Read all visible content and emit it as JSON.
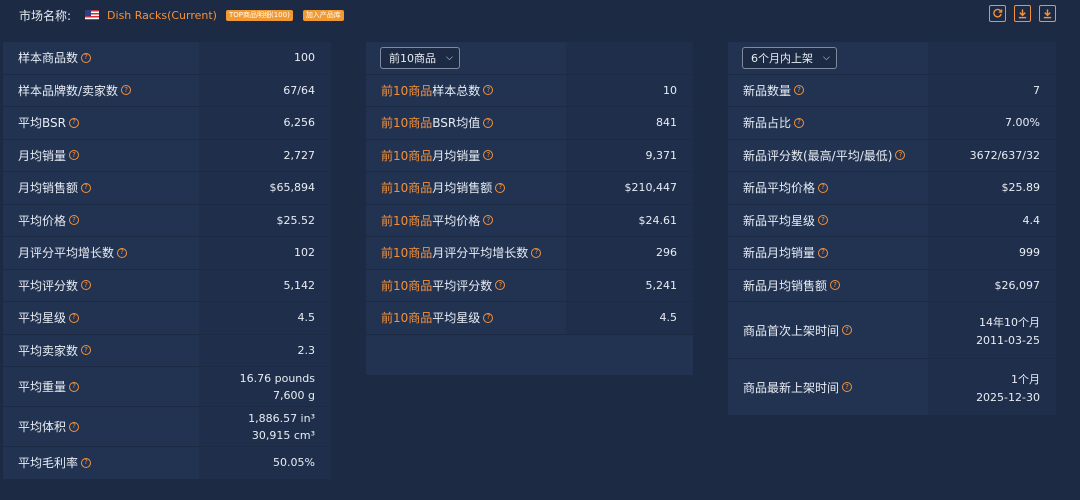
{
  "top": {
    "market_label": "市场名称:",
    "market_name": "Dish Racks(Current)",
    "tag1": "TOP商品明细(100)",
    "tag2": "加入产品库"
  },
  "icons": [
    "refresh-icon",
    "download-icon",
    "download-icon"
  ],
  "panel1": {
    "rows": [
      {
        "label": "样本商品数",
        "value": "100"
      },
      {
        "label": "样本品牌数/卖家数",
        "value": "67/64"
      },
      {
        "label": "平均BSR",
        "value": "6,256"
      },
      {
        "label": "月均销量",
        "value": "2,727"
      },
      {
        "label": "月均销售额",
        "value": "$65,894"
      },
      {
        "label": "平均价格",
        "value": "$25.52"
      },
      {
        "label": "月评分平均增长数",
        "value": "102"
      },
      {
        "label": "平均评分数",
        "value": "5,142"
      },
      {
        "label": "平均星级",
        "value": "4.5"
      },
      {
        "label": "平均卖家数",
        "value": "2.3"
      },
      {
        "label": "平均重量",
        "value": "16.76 pounds",
        "value2": "7,600 g"
      },
      {
        "label": "平均体积",
        "value": "1,886.57 in³",
        "value2": "30,915 cm³"
      },
      {
        "label": "平均毛利率",
        "value": "50.05%"
      }
    ]
  },
  "panel2": {
    "select": "前10商品",
    "prefix": "前10商品",
    "rows": [
      {
        "label": "样本总数",
        "value": "10"
      },
      {
        "label": "BSR均值",
        "value": "841"
      },
      {
        "label": "月均销量",
        "value": "9,371"
      },
      {
        "label": "月均销售额",
        "value": "$210,447"
      },
      {
        "label": "平均价格",
        "value": "$24.61"
      },
      {
        "label": "月评分平均增长数",
        "value": "296"
      },
      {
        "label": "平均评分数",
        "value": "5,241"
      },
      {
        "label": "平均星级",
        "value": "4.5"
      }
    ]
  },
  "panel3": {
    "select": "6个月内上架",
    "rows": [
      {
        "label": "新品数量",
        "value": "7"
      },
      {
        "label": "新品占比",
        "value": "7.00%"
      },
      {
        "label": "新品评分数(最高/平均/最低)",
        "value": "3672/637/32"
      },
      {
        "label": "新品平均价格",
        "value": "$25.89"
      },
      {
        "label": "新品平均星级",
        "value": "4.4"
      },
      {
        "label": "新品月均销量",
        "value": "999"
      },
      {
        "label": "新品月均销售额",
        "value": "$26,097"
      },
      {
        "label": "商品首次上架时间",
        "value": "14年10个月",
        "value2": "2011-03-25"
      },
      {
        "label": "商品最新上架时间",
        "value": "1个月",
        "value2": "2025-12-30"
      }
    ]
  },
  "help_glyph": "?"
}
